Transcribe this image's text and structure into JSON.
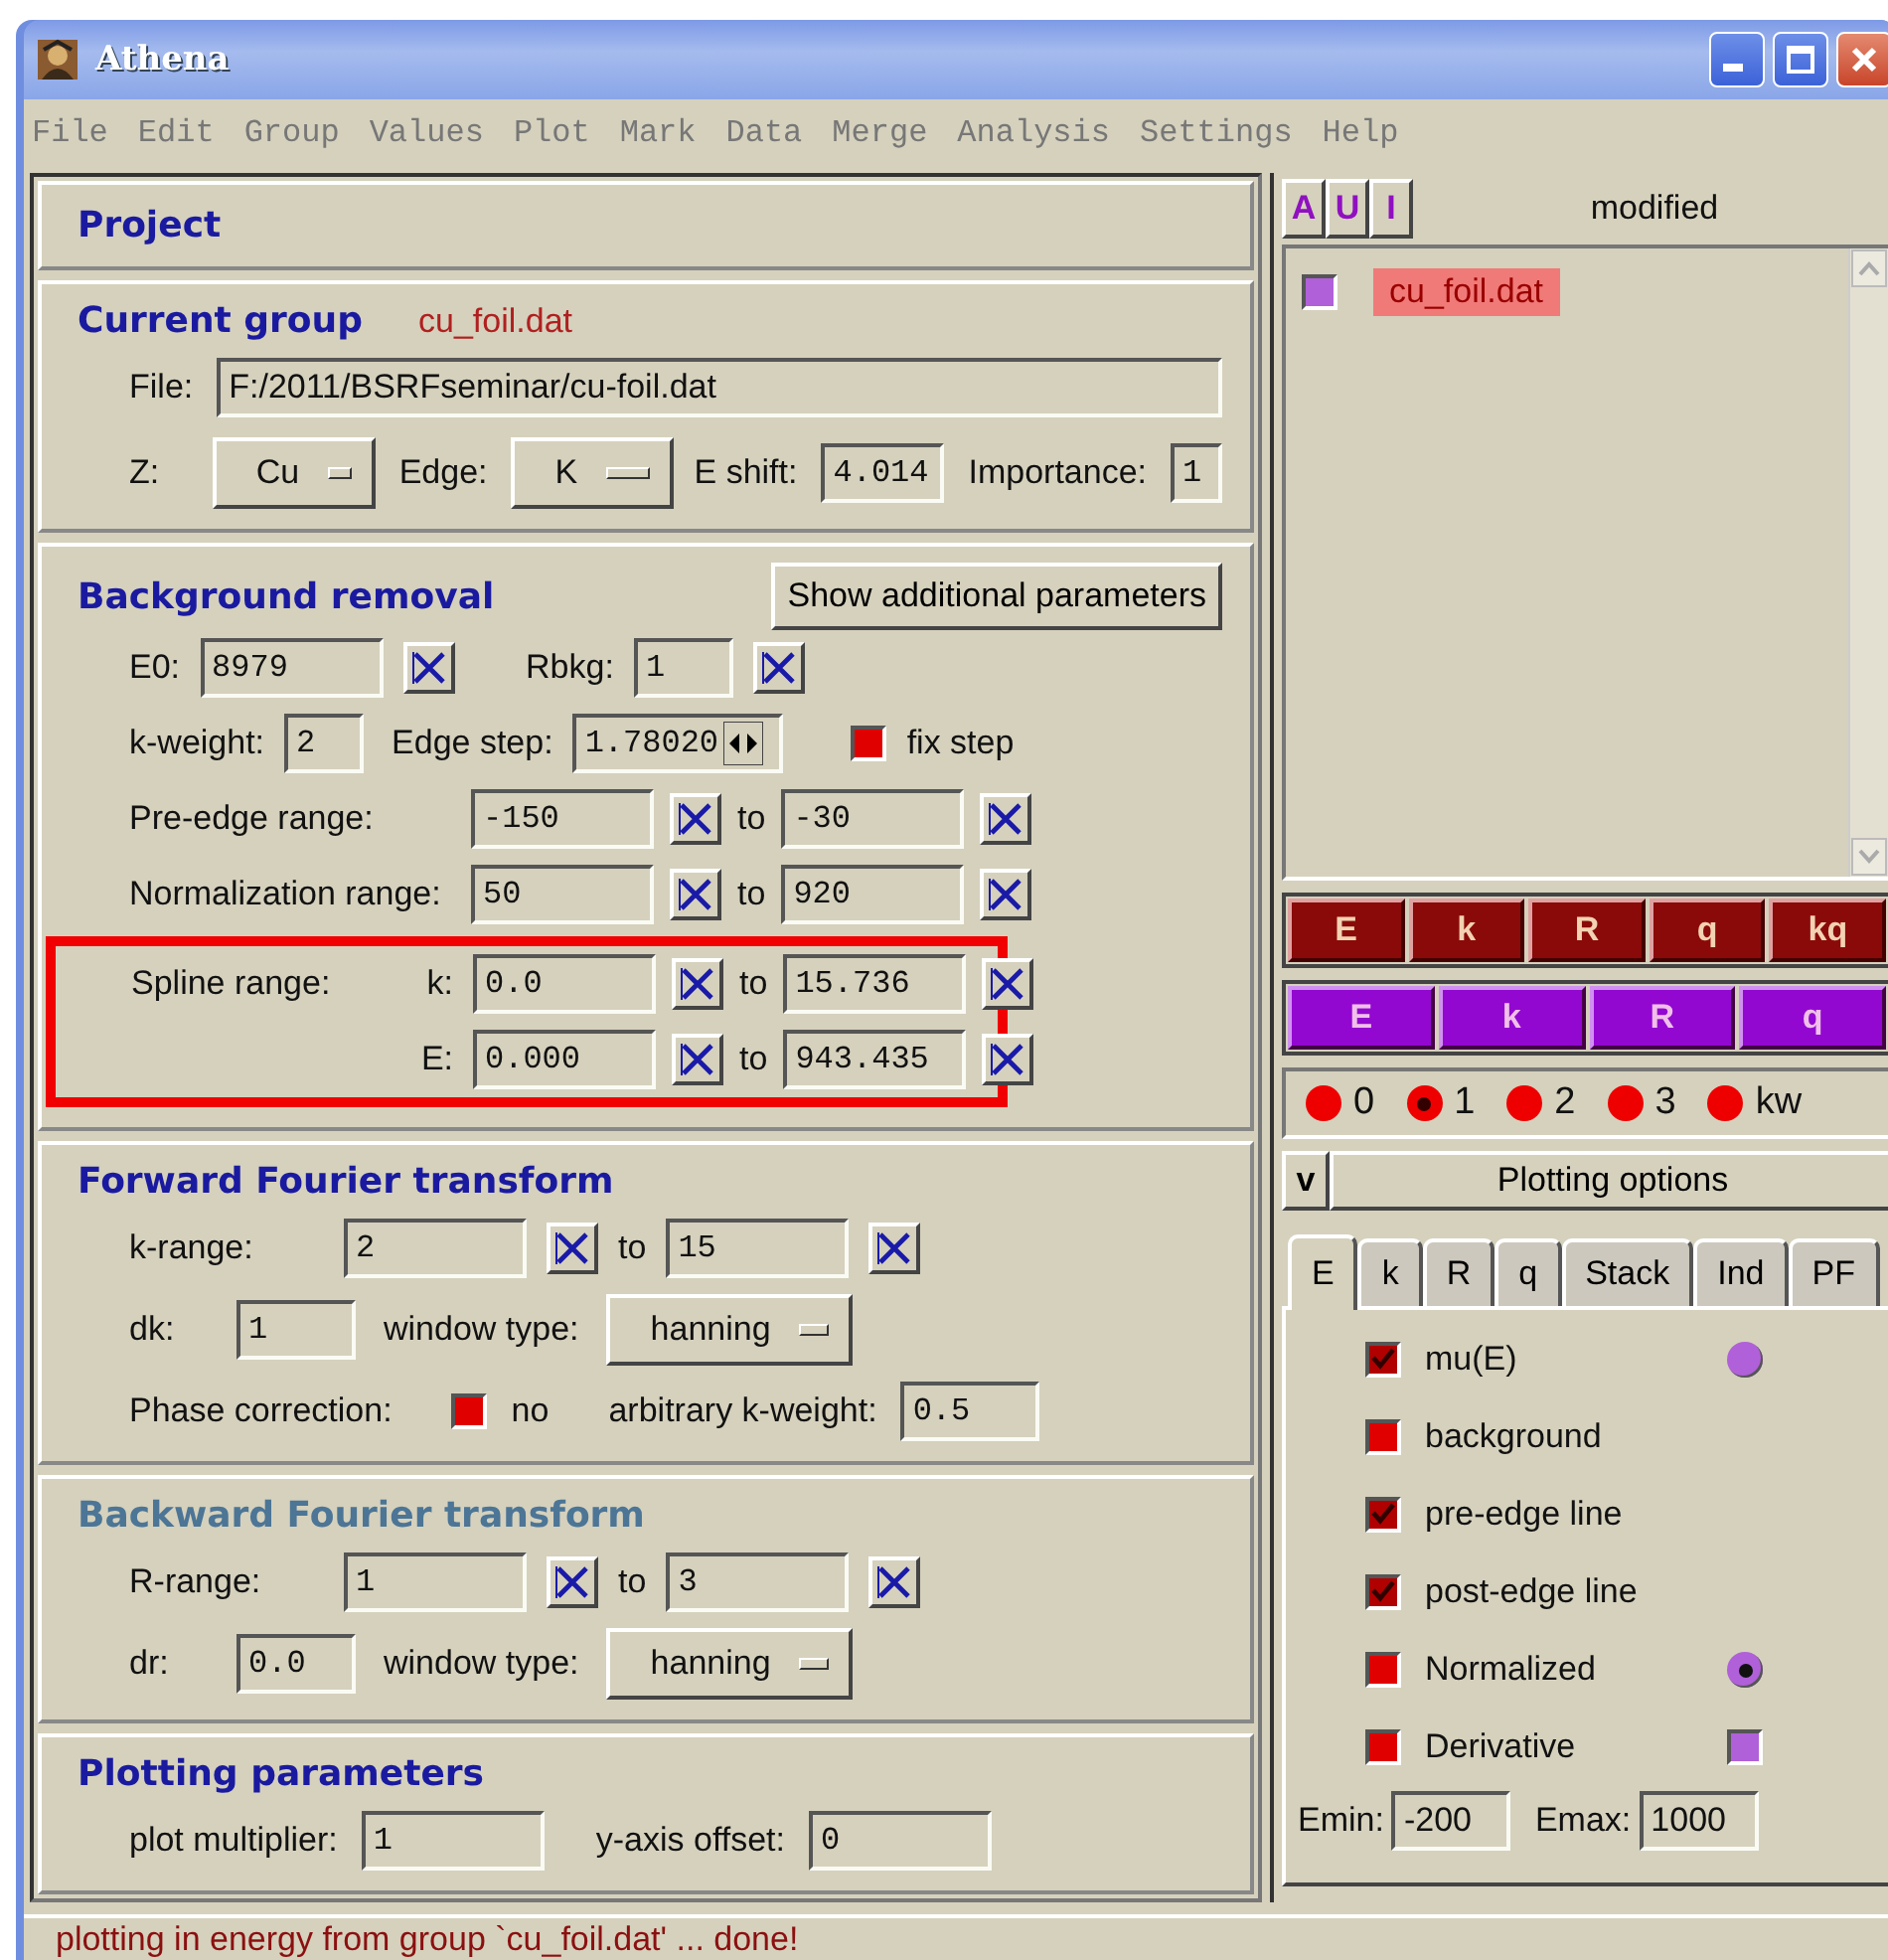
{
  "window": {
    "title": "Athena"
  },
  "menu": [
    "File",
    "Edit",
    "Group",
    "Values",
    "Plot",
    "Mark",
    "Data",
    "Merge",
    "Analysis",
    "Settings",
    "Help"
  ],
  "project": {
    "title": "Project"
  },
  "current_group": {
    "title": "Current group",
    "name": "cu_foil.dat",
    "file_label": "File:",
    "file": "F:/2011/BSRFseminar/cu-foil.dat",
    "z_label": "Z:",
    "z": "Cu",
    "edge_label": "Edge:",
    "edge": "K",
    "eshift_label": "E shift:",
    "eshift": "4.014",
    "importance_label": "Importance:",
    "importance": "1"
  },
  "background_removal": {
    "title": "Background removal",
    "button": "Show additional parameters",
    "e0": {
      "label": "E0:",
      "value": "8979"
    },
    "rbkg": {
      "label": "Rbkg:",
      "value": "1"
    },
    "kweight": {
      "label": "k-weight:",
      "value": "2"
    },
    "edge_step": {
      "label": "Edge step:",
      "value": "1.78020"
    },
    "fix_step": {
      "label": "fix step",
      "checked": false
    },
    "ranges": [
      {
        "label": "Pre-edge range:",
        "from": "-150",
        "to_label": "to",
        "to": "-30"
      },
      {
        "label": "Normalization range:",
        "from": "50",
        "to_label": "to",
        "to": "920"
      }
    ],
    "spline": {
      "label": "Spline range:",
      "highlighted": true,
      "rows": [
        {
          "label": "k:",
          "from": "0.0",
          "to_label": "to",
          "to": "15.736"
        },
        {
          "label": "E:",
          "from": "0.000",
          "to_label": "to",
          "to": "943.435"
        }
      ]
    }
  },
  "forward_ft": {
    "title": "Forward Fourier transform",
    "disabled": false,
    "range": {
      "label": "k-range:",
      "from": "2",
      "to_label": "to",
      "to": "15"
    },
    "step": {
      "label": "dk:",
      "value": "1"
    },
    "window_type": {
      "label": "window type:",
      "value": "hanning"
    },
    "phase_correction": {
      "label": "Phase correction:",
      "checked": false,
      "text": "no"
    },
    "arbitrary_kweight": {
      "label": "arbitrary k-weight:",
      "value": "0.5"
    }
  },
  "backward_ft": {
    "title": "Backward Fourier transform",
    "disabled": true,
    "range": {
      "label": "R-range:",
      "from": "1",
      "to_label": "to",
      "to": "3"
    },
    "step": {
      "label": "dr:",
      "value": "0.0"
    },
    "window_type": {
      "label": "window type:",
      "value": "hanning"
    }
  },
  "plotting_parameters": {
    "title": "Plotting parameters",
    "multiplier": {
      "label": "plot multiplier:",
      "value": "1"
    },
    "offset": {
      "label": "y-axis offset:",
      "value": "0"
    }
  },
  "group_list": {
    "buttons": [
      "A",
      "U",
      "I"
    ],
    "title": "modified",
    "items": [
      {
        "name": "cu_foil.dat",
        "checked": true,
        "selected": true
      }
    ]
  },
  "plot_single": [
    "E",
    "k",
    "R",
    "q",
    "kq"
  ],
  "plot_marked": [
    "E",
    "k",
    "R",
    "q"
  ],
  "kweights": [
    {
      "label": "0",
      "selected": false
    },
    {
      "label": "1",
      "selected": true
    },
    {
      "label": "2",
      "selected": false
    },
    {
      "label": "3",
      "selected": false
    },
    {
      "label": "kw",
      "selected": false
    }
  ],
  "plot_options": {
    "toggle": "v",
    "title": "Plotting options",
    "tabs": [
      {
        "label": "E",
        "selected": true
      },
      {
        "label": "k",
        "selected": false
      },
      {
        "label": "R",
        "selected": false
      },
      {
        "label": "q",
        "selected": false
      },
      {
        "label": "Stack",
        "selected": false
      },
      {
        "label": "Ind",
        "selected": false
      },
      {
        "label": "PF",
        "selected": false
      }
    ],
    "options": [
      {
        "label": "mu(E)",
        "checked": true,
        "extra": {
          "kind": "radio",
          "selected": false
        }
      },
      {
        "label": "background",
        "checked": false
      },
      {
        "label": "pre-edge line",
        "checked": true
      },
      {
        "label": "post-edge line",
        "checked": true
      },
      {
        "label": "Normalized",
        "checked": false,
        "extra": {
          "kind": "radio",
          "selected": true
        }
      },
      {
        "label": "Derivative",
        "checked": false,
        "extra": {
          "kind": "checkbox",
          "checked": false
        }
      }
    ],
    "emin": {
      "label": "Emin:",
      "value": "-200"
    },
    "emax": {
      "label": "Emax:",
      "value": "1000"
    }
  },
  "status": "plotting in energy from group `cu_foil.dat' ... done!"
}
